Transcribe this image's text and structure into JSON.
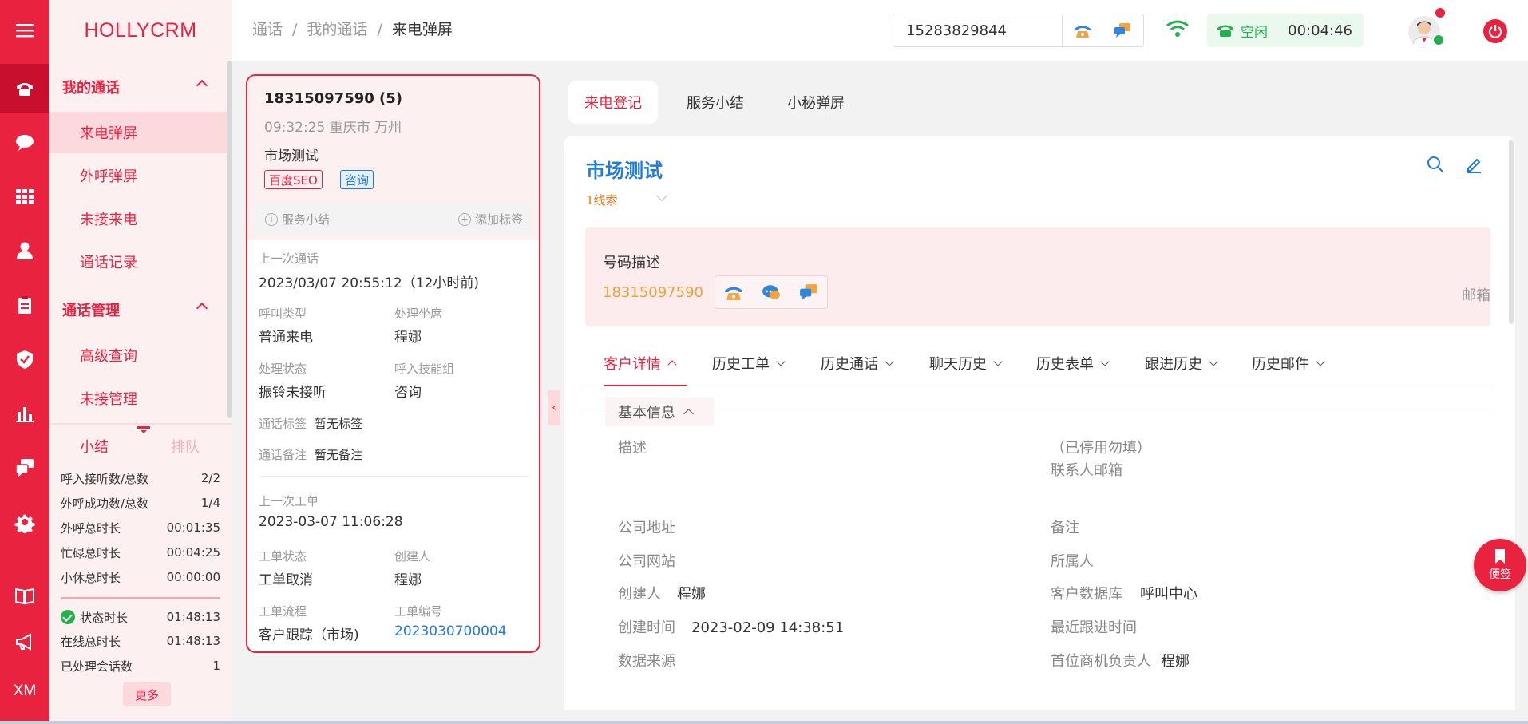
{
  "app": {
    "brand": "HOLLYCRM"
  },
  "breadcrumb": [
    "通话",
    "我的通话",
    "来电弹屏"
  ],
  "header": {
    "phone_value": "15283829844",
    "status_label": "空闲",
    "timer": "00:04:46"
  },
  "rail": {
    "icons": [
      "menu-icon",
      "phone-icon",
      "chat-icon",
      "grid-icon",
      "user-icon",
      "clipboard-icon",
      "shield-icon",
      "bar-chart-icon",
      "message-icon",
      "gear-icon",
      "book-icon",
      "megaphone-icon"
    ],
    "xm_label": "XM"
  },
  "menu": {
    "group1": "我的通话",
    "group1_items": [
      "来电弹屏",
      "外呼弹屏",
      "未接来电",
      "通话记录"
    ],
    "group2": "通话管理",
    "group2_items": [
      "高级查询",
      "未接管理"
    ]
  },
  "stats": {
    "tab_summary": "小结",
    "tab_queue": "排队",
    "rows": [
      {
        "label": "呼入接听数/总数",
        "value": "2/2"
      },
      {
        "label": "外呼成功数/总数",
        "value": "1/4"
      },
      {
        "label": "外呼总时长",
        "value": "00:01:35"
      },
      {
        "label": "忙碌总时长",
        "value": "00:04:25"
      },
      {
        "label": "小休总时长",
        "value": "00:00:00"
      }
    ],
    "rows2": [
      {
        "label": "状态时长",
        "value": "01:48:13"
      },
      {
        "label": "在线总时长",
        "value": "01:48:13"
      },
      {
        "label": "已处理会话数",
        "value": "1"
      }
    ],
    "more": "更多"
  },
  "call_card": {
    "number": "18315097590 (5)",
    "meta": "09:32:25 重庆市 万州",
    "customer": "市场测试",
    "tags": [
      "百度SEO",
      "咨询"
    ],
    "action_summary": "服务小结",
    "action_add_tag": "添加标签",
    "last_call_label": "上一次通话",
    "last_call_value": "2023/03/07 20:55:12（12小时前)",
    "call_type_label": "呼叫类型",
    "call_type_value": "普通来电",
    "agent_label": "处理坐席",
    "agent_value": "程娜",
    "status_label": "处理状态",
    "status_value": "振铃未接听",
    "skill_label": "呼入技能组",
    "skill_value": "咨询",
    "tag_label": "通话标签",
    "tag_value": "暂无标签",
    "note_label": "通话备注",
    "note_value": "暂无备注",
    "last_ticket_label": "上一次工单",
    "last_ticket_value": "2023-03-07 11:06:28",
    "ticket_status_label": "工单状态",
    "ticket_status_value": "工单取消",
    "creator_label": "创建人",
    "creator_value": "程娜",
    "flow_label": "工单流程",
    "flow_value": "客户跟踪（市场)",
    "ticket_no_label": "工单编号",
    "ticket_no_value": "2023030700004"
  },
  "right_tabs": [
    "来电登记",
    "服务小结",
    "小秘弹屏"
  ],
  "panel": {
    "title": "市场测试",
    "clue": "1线索",
    "num_desc_label": "号码描述",
    "num_desc_number": "18315097590",
    "mail": "邮箱",
    "subtabs": [
      "客户详情",
      "历史工单",
      "历史通话",
      "聊天历史",
      "历史表单",
      "跟进历史",
      "历史邮件"
    ],
    "basic_info": "基本信息",
    "fields": {
      "desc": "描述",
      "contact_email": "（已停用勿填）联系人邮箱",
      "company_address": "公司地址",
      "remark": "备注",
      "company_site": "公司网站",
      "owner": "所属人",
      "creator_label": "创建人",
      "creator_value": "程娜",
      "customer_db_label": "客户数据库",
      "customer_db_value": "呼叫中心",
      "created_label": "创建时间",
      "created_value": "2023-02-09 14:38:51",
      "last_follow": "最近跟进时间",
      "data_source": "数据来源",
      "first_owner_label": "首位商机负责人",
      "first_owner_value": "程娜"
    }
  },
  "sticky": {
    "label": "便签"
  },
  "colors": {
    "accent": "#e8223f",
    "link": "#1f7bde",
    "ok": "#22b14c",
    "orange": "#e87a1d"
  }
}
